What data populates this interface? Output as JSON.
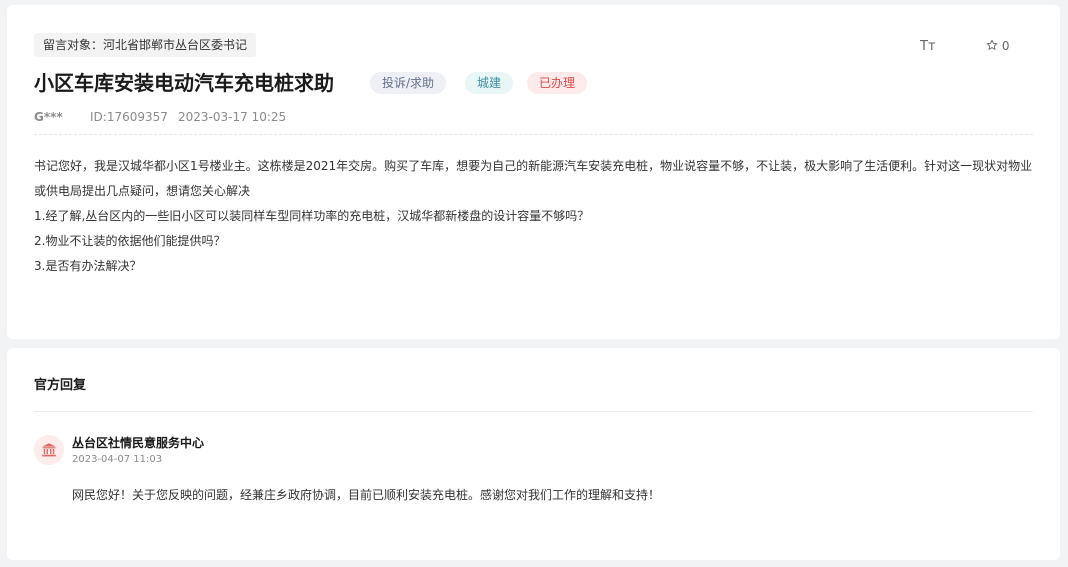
{
  "message": {
    "recipient_label": "留言对象：河北省邯郸市丛台区委书记",
    "font_toggle_label": "Tт",
    "favorite_count": "0",
    "title": "小区车库安装电动汽车充电桩求助",
    "tags": {
      "category": "投诉/求助",
      "field": "城建",
      "status": "已办理"
    },
    "author": "G***",
    "id_label": "ID:17609357",
    "datetime": "2023-03-17 10:25",
    "body": [
      "书记您好，我是汉城华都小区1号楼业主。这栋楼是2021年交房。购买了车库，想要为自己的新能源汽车安装充电桩，物业说容量不够，不让装，极大影响了生活便利。针对这一现状对物业或供电局提出几点疑问，想请您关心解决",
      "1.经了解,丛台区内的一些旧小区可以装同样车型同样功率的充电桩，汉城华都新楼盘的设计容量不够吗？",
      "2.物业不让装的依据他们能提供吗？",
      "3.是否有办法解决？"
    ]
  },
  "reply": {
    "heading": "官方回复",
    "org_name": "丛台区社情民意服务中心",
    "datetime": "2023-04-07 11:03",
    "text": "网民您好！关于您反映的问题，经兼庄乡政府协调，目前已顺利安装充电桩。感谢您对我们工作的理解和支持！"
  },
  "icons": {
    "favorite": "star-outline-icon",
    "org": "government-building-icon"
  },
  "colors": {
    "status_red": "#e0474a",
    "city_teal": "#3f8fa0",
    "category_slate": "#62708a"
  }
}
